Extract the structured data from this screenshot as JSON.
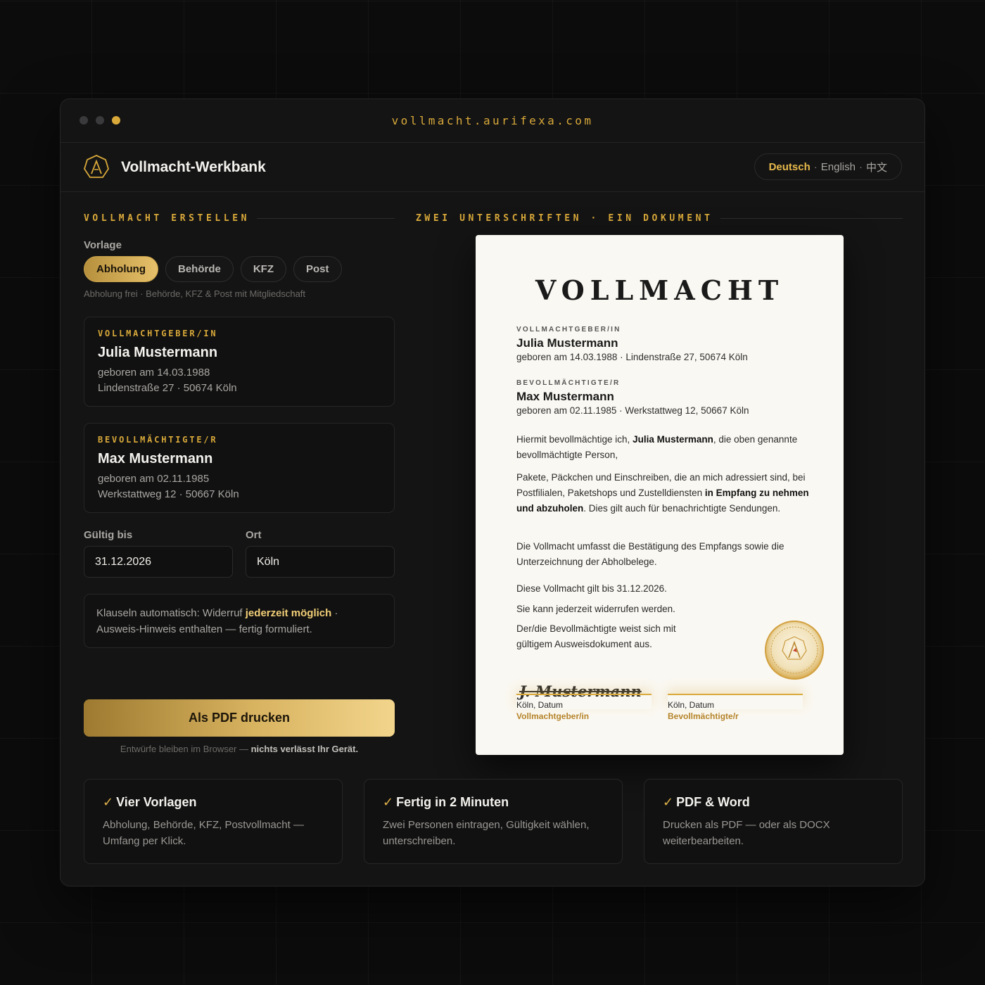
{
  "browser": {
    "url": "vollmacht.aurifexa.com"
  },
  "app": {
    "title": "Vollmacht-Werkbank"
  },
  "languages": {
    "active": "Deutsch",
    "other1": "English",
    "other2": "中文",
    "separator": "·"
  },
  "form": {
    "section_title": "VOLLMACHT ERSTELLEN",
    "template_label": "Vorlage",
    "templates": [
      "Abholung",
      "Behörde",
      "KFZ",
      "Post"
    ],
    "template_hint": "Abholung frei · Behörde, KFZ & Post mit Mitgliedschaft",
    "grantor": {
      "tag": "VOLLMACHTGEBER/IN",
      "name": "Julia Mustermann",
      "birth": "geboren am 14.03.1988",
      "address": "Lindenstraße 27 · 50674 Köln"
    },
    "agent": {
      "tag": "BEVOLLMÄCHTIGTE/R",
      "name": "Max Mustermann",
      "birth": "geboren am 02.11.1985",
      "address": "Werkstattweg 12 · 50667 Köln"
    },
    "valid_until_label": "Gültig bis",
    "valid_until_value": "31.12.2026",
    "place_label": "Ort",
    "place_value": "Köln",
    "clause_prefix": "Klauseln automatisch: Widerruf ",
    "clause_highlight": "jederzeit möglich",
    "clause_suffix": " · Ausweis-Hinweis enthalten — fertig formuliert.",
    "print_button": "Als PDF drucken",
    "footnote_prefix": "Entwürfe bleiben im Browser — ",
    "footnote_bold": "nichts verlässt Ihr Gerät."
  },
  "preview": {
    "section_title": "ZWEI UNTERSCHRIFTEN · EIN DOKUMENT",
    "doc_title": "VOLLMACHT",
    "grantor_label": "VOLLMACHTGEBER/IN",
    "grantor_name": "Julia Mustermann",
    "grantor_meta": "geboren am 14.03.1988 · Lindenstraße 27, 50674 Köln",
    "agent_label": "BEVOLLMÄCHTIGTE/R",
    "agent_name": "Max Mustermann",
    "agent_meta": "geboren am 02.11.1985 · Werkstattweg 12, 50667 Köln",
    "p1_a": "Hiermit bevollmächtige ich, ",
    "p1_b": "Julia Mustermann",
    "p1_c": ", die oben genannte bevollmächtigte Person,",
    "p2_a": "Pakete, Päckchen und Einschreiben, die an mich adressiert sind, bei Postfilialen, Paketshops und Zustelldiensten ",
    "p2_b": "in Empfang zu nehmen und abzuholen",
    "p2_c": ". Dies gilt auch für benachrichtigte Sendungen.",
    "p3": "Die Vollmacht umfasst die Bestätigung des Empfangs sowie die Unterzeichnung der Abholbelege.",
    "p4": "Diese Vollmacht gilt bis 31.12.2026.",
    "p5": "Sie kann jederzeit widerrufen werden.",
    "p6": "Der/die Bevollmächtigte weist sich mit gültigem Ausweisdokument aus.",
    "signature_script": "J. Mustermann",
    "sig1_place": "Köln, Datum",
    "sig1_role": "Vollmachtgeber/in",
    "sig2_place": "Köln, Datum",
    "sig2_role": "Bevollmächtigte/r"
  },
  "features": [
    {
      "title": "Vier Vorlagen",
      "desc": "Abholung, Behörde, KFZ, Postvollmacht — Umfang per Klick."
    },
    {
      "title": "Fertig in 2 Minuten",
      "desc": "Zwei Personen eintragen, Gültigkeit wählen, unterschreiben."
    },
    {
      "title": "PDF & Word",
      "desc": "Drucken als PDF — oder als DOCX weiterbearbeiten."
    }
  ],
  "icons": {
    "check": "check-icon",
    "logo": "logo-icon",
    "seal": "seal-icon"
  },
  "colors": {
    "accent": "#d9a93a",
    "background": "#0c0c0c",
    "paper": "#faf8f2"
  }
}
